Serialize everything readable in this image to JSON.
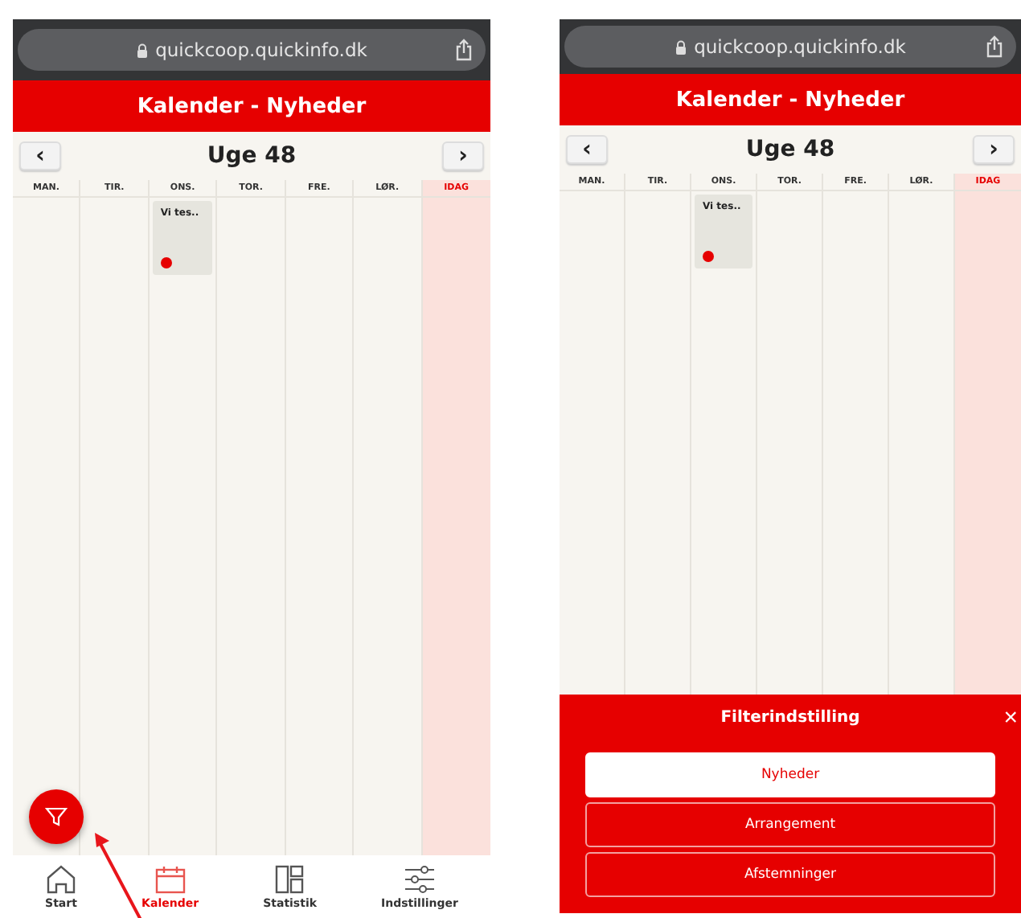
{
  "phones": [
    {
      "browser": {
        "url": "quickcoop.quickinfo.dk"
      },
      "header": {
        "title": "Kalender - Nyheder"
      },
      "week": {
        "prev": "‹",
        "title": "Uge 48",
        "next": "›"
      },
      "days": [
        {
          "label": "MAN.",
          "today": false
        },
        {
          "label": "TIR.",
          "today": false
        },
        {
          "label": "ONS.",
          "today": false,
          "events": [
            {
              "title": "Vi tes.."
            }
          ]
        },
        {
          "label": "TOR.",
          "today": false
        },
        {
          "label": "FRE.",
          "today": false
        },
        {
          "label": "LØR.",
          "today": false
        },
        {
          "label": "IDAG",
          "today": true
        }
      ],
      "filter_fab": true,
      "pointer_arrow": true,
      "tab_bar": [
        {
          "kind": "home",
          "label": "Start",
          "selected": false
        },
        {
          "kind": "calendar",
          "label": "Kalender",
          "selected": true
        },
        {
          "kind": "stats",
          "label": "Statistik",
          "selected": false
        },
        {
          "kind": "settings",
          "label": "Indstillinger",
          "selected": false
        }
      ]
    },
    {
      "browser": {
        "url": "quickcoop.quickinfo.dk"
      },
      "header": {
        "title": "Kalender - Nyheder"
      },
      "week": {
        "prev": "‹",
        "title": "Uge 48",
        "next": "›"
      },
      "days": [
        {
          "label": "MAN.",
          "today": false
        },
        {
          "label": "TIR.",
          "today": false
        },
        {
          "label": "ONS.",
          "today": false,
          "events": [
            {
              "title": "Vi tes.."
            }
          ]
        },
        {
          "label": "TOR.",
          "today": false
        },
        {
          "label": "FRE.",
          "today": false
        },
        {
          "label": "LØR.",
          "today": false
        },
        {
          "label": "IDAG",
          "today": true
        }
      ],
      "filter_sheet": {
        "title": "Filterindstilling",
        "close": "×",
        "options": [
          {
            "label": "Nyheder",
            "selected": true
          },
          {
            "label": "Arrangement",
            "selected": false
          },
          {
            "label": "Afstemninger",
            "selected": false
          }
        ]
      }
    }
  ]
}
